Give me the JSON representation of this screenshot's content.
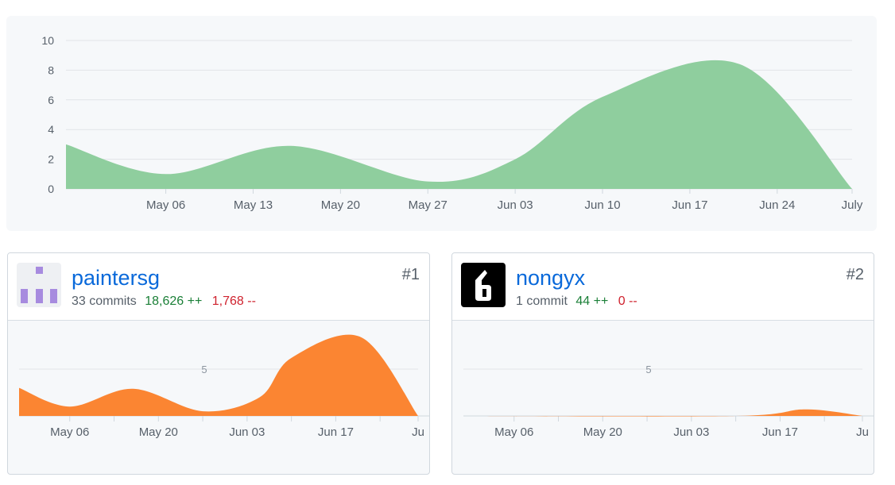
{
  "main_chart": {
    "chart_data": {
      "type": "area",
      "yticks": [
        0,
        2,
        4,
        6,
        8,
        10
      ],
      "ylim": [
        0,
        10
      ],
      "xtick_labels": [
        "May 06",
        "May 13",
        "May 20",
        "May 27",
        "Jun 03",
        "Jun 10",
        "Jun 17",
        "Jun 24",
        "July"
      ],
      "x": [
        "Apr 28",
        "May 06",
        "May 16",
        "May 27",
        "Jun 03",
        "Jun 10",
        "Jun 21",
        "July"
      ],
      "values": [
        3,
        1,
        2.9,
        0.5,
        2,
        6.2,
        8.4,
        0
      ],
      "color": "#8fce9e",
      "grid": true
    }
  },
  "contributors": [
    {
      "rank": "#1",
      "username": "paintersg",
      "commits": "33 commits",
      "additions": "18,626 ++",
      "deletions": "1,768 --",
      "avatar_colors": [
        "#a78bdf",
        "#eef0f3"
      ],
      "chart_data": {
        "type": "area",
        "ytick_label": "5",
        "xtick_labels": [
          "May 06",
          "May 20",
          "Jun 03",
          "Jun 17",
          "Ju"
        ],
        "x": [
          "Apr 28",
          "May 06",
          "May 16",
          "May 27",
          "Jun 05",
          "Jun 10",
          "Jun 21",
          "July"
        ],
        "values": [
          3,
          1,
          2.9,
          0.5,
          2,
          6.2,
          8.4,
          0
        ],
        "color": "#fb8532"
      }
    },
    {
      "rank": "#2",
      "username": "nongyx",
      "commits": "1 commit",
      "additions": "44 ++",
      "deletions": "0 --",
      "avatar_colors": [
        "#000000",
        "#ffffff"
      ],
      "chart_data": {
        "type": "area",
        "ytick_label": "5",
        "xtick_labels": [
          "May 06",
          "May 20",
          "Jun 03",
          "Jun 17",
          "Ju"
        ],
        "x": [
          "Apr 28",
          "Jun 10",
          "Jun 21",
          "July"
        ],
        "values": [
          0,
          0,
          0.7,
          0
        ],
        "color": "#fb8532"
      }
    }
  ]
}
